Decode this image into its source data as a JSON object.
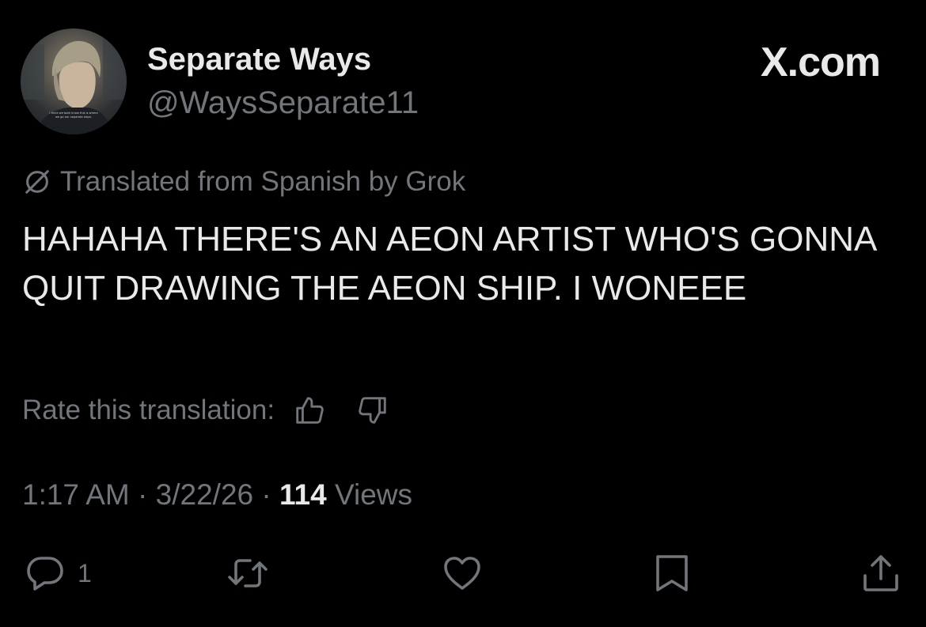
{
  "author": {
    "display_name": "Separate Ways",
    "handle": "@WaysSeparate11",
    "avatar_caption": "I think we both know this is where we go our separate ways."
  },
  "brand": "X.com",
  "translation": {
    "icon": "grok-slash-circle-icon",
    "notice": "Translated from Spanish by Grok",
    "rate_label": "Rate this translation:"
  },
  "tweet": {
    "text": "HAHAHA THERE'S AN AEON ARTIST WHO'S GONNA QUIT DRAWING THE AEON SHIP. I WONEEE",
    "time": "1:17 AM",
    "date": "3/22/26",
    "separator": " · ",
    "views_count": "114",
    "views_label": " Views"
  },
  "actions": {
    "reply_count": "1",
    "icons": [
      "reply-icon",
      "retweet-icon",
      "like-icon",
      "bookmark-icon",
      "share-icon"
    ]
  },
  "colors": {
    "background": "#000000",
    "text_primary": "#e7e9ea",
    "text_secondary": "#71767b"
  }
}
